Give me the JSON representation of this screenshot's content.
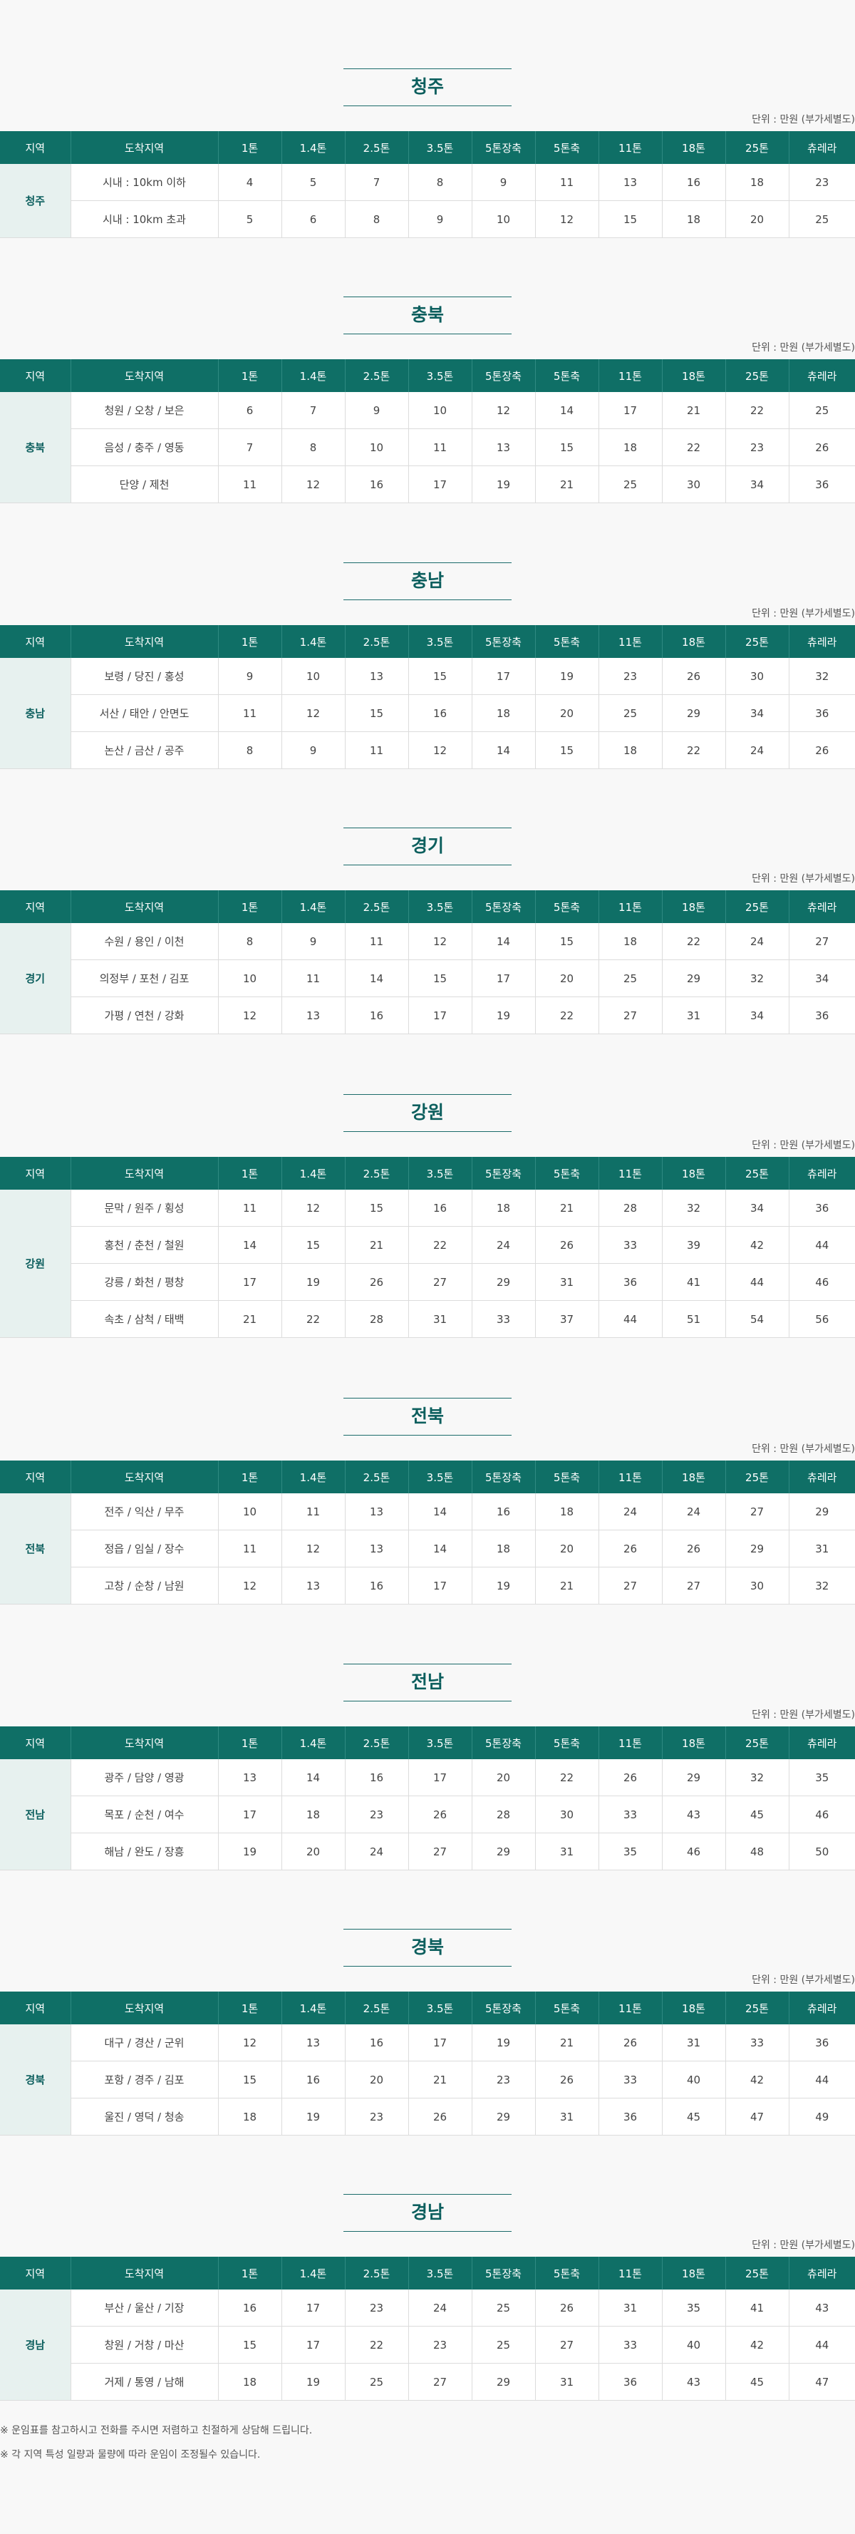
{
  "headers": [
    "지역",
    "도착지역",
    "1톤",
    "1.4톤",
    "2.5톤",
    "3.5톤",
    "5톤장축",
    "5톤축",
    "11톤",
    "18톤",
    "25톤",
    "츄레라"
  ],
  "unit_label": "단위 : 만원 (부가세별도)",
  "sections": [
    {
      "title": "청주",
      "region": "청주",
      "rows": [
        {
          "dest": "시내 : 10km 이하",
          "values": [
            "4",
            "5",
            "7",
            "8",
            "9",
            "11",
            "13",
            "16",
            "18",
            "23"
          ]
        },
        {
          "dest": "시내 : 10km 초과",
          "values": [
            "5",
            "6",
            "8",
            "9",
            "10",
            "12",
            "15",
            "18",
            "20",
            "25"
          ]
        }
      ]
    },
    {
      "title": "충북",
      "region": "충북",
      "rows": [
        {
          "dest": "청원 / 오창 / 보은",
          "values": [
            "6",
            "7",
            "9",
            "10",
            "12",
            "14",
            "17",
            "21",
            "22",
            "25"
          ]
        },
        {
          "dest": "음성 / 충주 / 영동",
          "values": [
            "7",
            "8",
            "10",
            "11",
            "13",
            "15",
            "18",
            "22",
            "23",
            "26"
          ]
        },
        {
          "dest": "단양 / 제천",
          "values": [
            "11",
            "12",
            "16",
            "17",
            "19",
            "21",
            "25",
            "30",
            "34",
            "36"
          ]
        }
      ]
    },
    {
      "title": "충남",
      "region": "충남",
      "rows": [
        {
          "dest": "보령 / 당진 / 홍성",
          "values": [
            "9",
            "10",
            "13",
            "15",
            "17",
            "19",
            "23",
            "26",
            "30",
            "32"
          ]
        },
        {
          "dest": "서산 / 태안 / 안면도",
          "values": [
            "11",
            "12",
            "15",
            "16",
            "18",
            "20",
            "25",
            "29",
            "34",
            "36"
          ]
        },
        {
          "dest": "논산 / 금산 / 공주",
          "values": [
            "8",
            "9",
            "11",
            "12",
            "14",
            "15",
            "18",
            "22",
            "24",
            "26"
          ]
        }
      ]
    },
    {
      "title": "경기",
      "region": "경기",
      "rows": [
        {
          "dest": "수원 / 용인 / 이천",
          "values": [
            "8",
            "9",
            "11",
            "12",
            "14",
            "15",
            "18",
            "22",
            "24",
            "27"
          ]
        },
        {
          "dest": "의정부 / 포천 / 김포",
          "values": [
            "10",
            "11",
            "14",
            "15",
            "17",
            "20",
            "25",
            "29",
            "32",
            "34"
          ]
        },
        {
          "dest": "가평 / 연천 / 강화",
          "values": [
            "12",
            "13",
            "16",
            "17",
            "19",
            "22",
            "27",
            "31",
            "34",
            "36"
          ]
        }
      ]
    },
    {
      "title": "강원",
      "region": "강원",
      "rows": [
        {
          "dest": "문막 / 원주 / 횡성",
          "values": [
            "11",
            "12",
            "15",
            "16",
            "18",
            "21",
            "28",
            "32",
            "34",
            "36"
          ]
        },
        {
          "dest": "홍천 / 춘천 / 철원",
          "values": [
            "14",
            "15",
            "21",
            "22",
            "24",
            "26",
            "33",
            "39",
            "42",
            "44"
          ]
        },
        {
          "dest": "강릉 / 화천 / 평창",
          "values": [
            "17",
            "19",
            "26",
            "27",
            "29",
            "31",
            "36",
            "41",
            "44",
            "46"
          ]
        },
        {
          "dest": "속초 / 삼척 / 태백",
          "values": [
            "21",
            "22",
            "28",
            "31",
            "33",
            "37",
            "44",
            "51",
            "54",
            "56"
          ]
        }
      ]
    },
    {
      "title": "전북",
      "region": "전북",
      "rows": [
        {
          "dest": "전주 / 익산 / 무주",
          "values": [
            "10",
            "11",
            "13",
            "14",
            "16",
            "18",
            "24",
            "24",
            "27",
            "29"
          ]
        },
        {
          "dest": "정읍 / 임실 / 장수",
          "values": [
            "11",
            "12",
            "13",
            "14",
            "18",
            "20",
            "26",
            "26",
            "29",
            "31"
          ]
        },
        {
          "dest": "고창 / 순창 / 남원",
          "values": [
            "12",
            "13",
            "16",
            "17",
            "19",
            "21",
            "27",
            "27",
            "30",
            "32"
          ]
        }
      ]
    },
    {
      "title": "전남",
      "region": "전남",
      "rows": [
        {
          "dest": "광주 / 담양 / 영광",
          "values": [
            "13",
            "14",
            "16",
            "17",
            "20",
            "22",
            "26",
            "29",
            "32",
            "35"
          ]
        },
        {
          "dest": "목포 / 순천 / 여수",
          "values": [
            "17",
            "18",
            "23",
            "26",
            "28",
            "30",
            "33",
            "43",
            "45",
            "46"
          ]
        },
        {
          "dest": "해남 / 완도 / 장흥",
          "values": [
            "19",
            "20",
            "24",
            "27",
            "29",
            "31",
            "35",
            "46",
            "48",
            "50"
          ]
        }
      ]
    },
    {
      "title": "경북",
      "region": "경북",
      "rows": [
        {
          "dest": "대구 / 경산 / 군위",
          "values": [
            "12",
            "13",
            "16",
            "17",
            "19",
            "21",
            "26",
            "31",
            "33",
            "36"
          ]
        },
        {
          "dest": "포항 / 경주 / 김포",
          "values": [
            "15",
            "16",
            "20",
            "21",
            "23",
            "26",
            "33",
            "40",
            "42",
            "44"
          ]
        },
        {
          "dest": "울진 / 영덕 / 청송",
          "values": [
            "18",
            "19",
            "23",
            "26",
            "29",
            "31",
            "36",
            "45",
            "47",
            "49"
          ]
        }
      ]
    },
    {
      "title": "경남",
      "region": "경남",
      "rows": [
        {
          "dest": "부산 / 울산 / 기장",
          "values": [
            "16",
            "17",
            "23",
            "24",
            "25",
            "26",
            "31",
            "35",
            "41",
            "43"
          ]
        },
        {
          "dest": "창원 / 거창 / 마산",
          "values": [
            "15",
            "17",
            "22",
            "23",
            "25",
            "27",
            "33",
            "40",
            "42",
            "44"
          ]
        },
        {
          "dest": "거제 / 통영 / 남해",
          "values": [
            "18",
            "19",
            "25",
            "27",
            "29",
            "31",
            "36",
            "43",
            "45",
            "47"
          ]
        }
      ]
    }
  ],
  "notes": [
    "※ 운임표를 참고하시고 전화를 주시면 저렴하고 친절하게 상담해 드립니다.",
    "※ 각 지역 특성 일량과 물량에 따라 운임이 조정될수 있습니다."
  ]
}
